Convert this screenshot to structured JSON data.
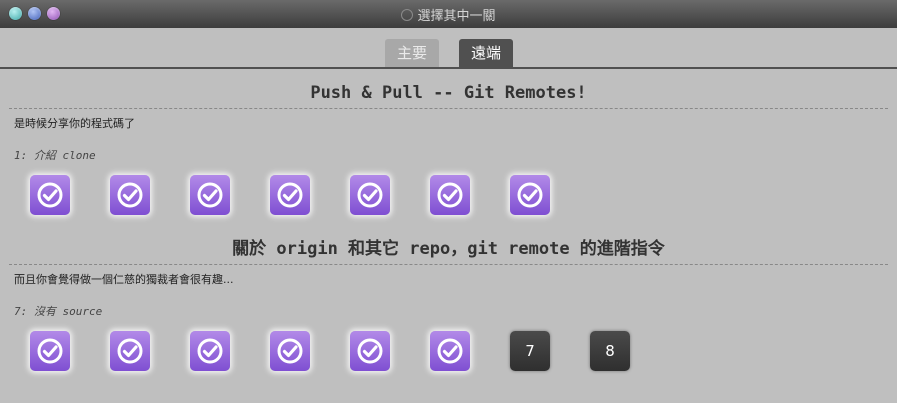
{
  "window": {
    "title": "選擇其中一關"
  },
  "tabs": [
    {
      "label": "主要",
      "active": false
    },
    {
      "label": "遠端",
      "active": true
    }
  ],
  "sections": [
    {
      "heading": "Push & Pull -- Git Remotes!",
      "description": "是時候分享你的程式碼了",
      "level_label": "1: 介紹 clone",
      "levels": [
        {
          "status": "complete",
          "icon": "check-circle-icon"
        },
        {
          "status": "complete",
          "icon": "check-circle-icon"
        },
        {
          "status": "complete",
          "icon": "check-circle-icon"
        },
        {
          "status": "complete",
          "icon": "check-circle-icon"
        },
        {
          "status": "complete",
          "icon": "check-circle-icon"
        },
        {
          "status": "complete",
          "icon": "check-circle-icon"
        },
        {
          "status": "complete",
          "icon": "check-circle-icon"
        }
      ]
    },
    {
      "heading": "關於 origin 和其它 repo，git remote 的進階指令",
      "description": "而且你會覺得做一個仁慈的獨裁者會很有趣...",
      "level_label": "7: 沒有 source",
      "levels": [
        {
          "status": "complete",
          "icon": "check-circle-icon"
        },
        {
          "status": "complete",
          "icon": "check-circle-icon"
        },
        {
          "status": "complete",
          "icon": "check-circle-icon"
        },
        {
          "status": "complete",
          "icon": "check-circle-icon"
        },
        {
          "status": "complete",
          "icon": "check-circle-icon"
        },
        {
          "status": "complete",
          "icon": "check-circle-icon"
        },
        {
          "status": "incomplete",
          "number": "7"
        },
        {
          "status": "incomplete",
          "number": "8"
        }
      ]
    }
  ],
  "colors": {
    "complete_top": "#b28ae8",
    "complete_bottom": "#7f4fd2",
    "incomplete": "#3c3c3c",
    "active_tab": "#505050"
  }
}
